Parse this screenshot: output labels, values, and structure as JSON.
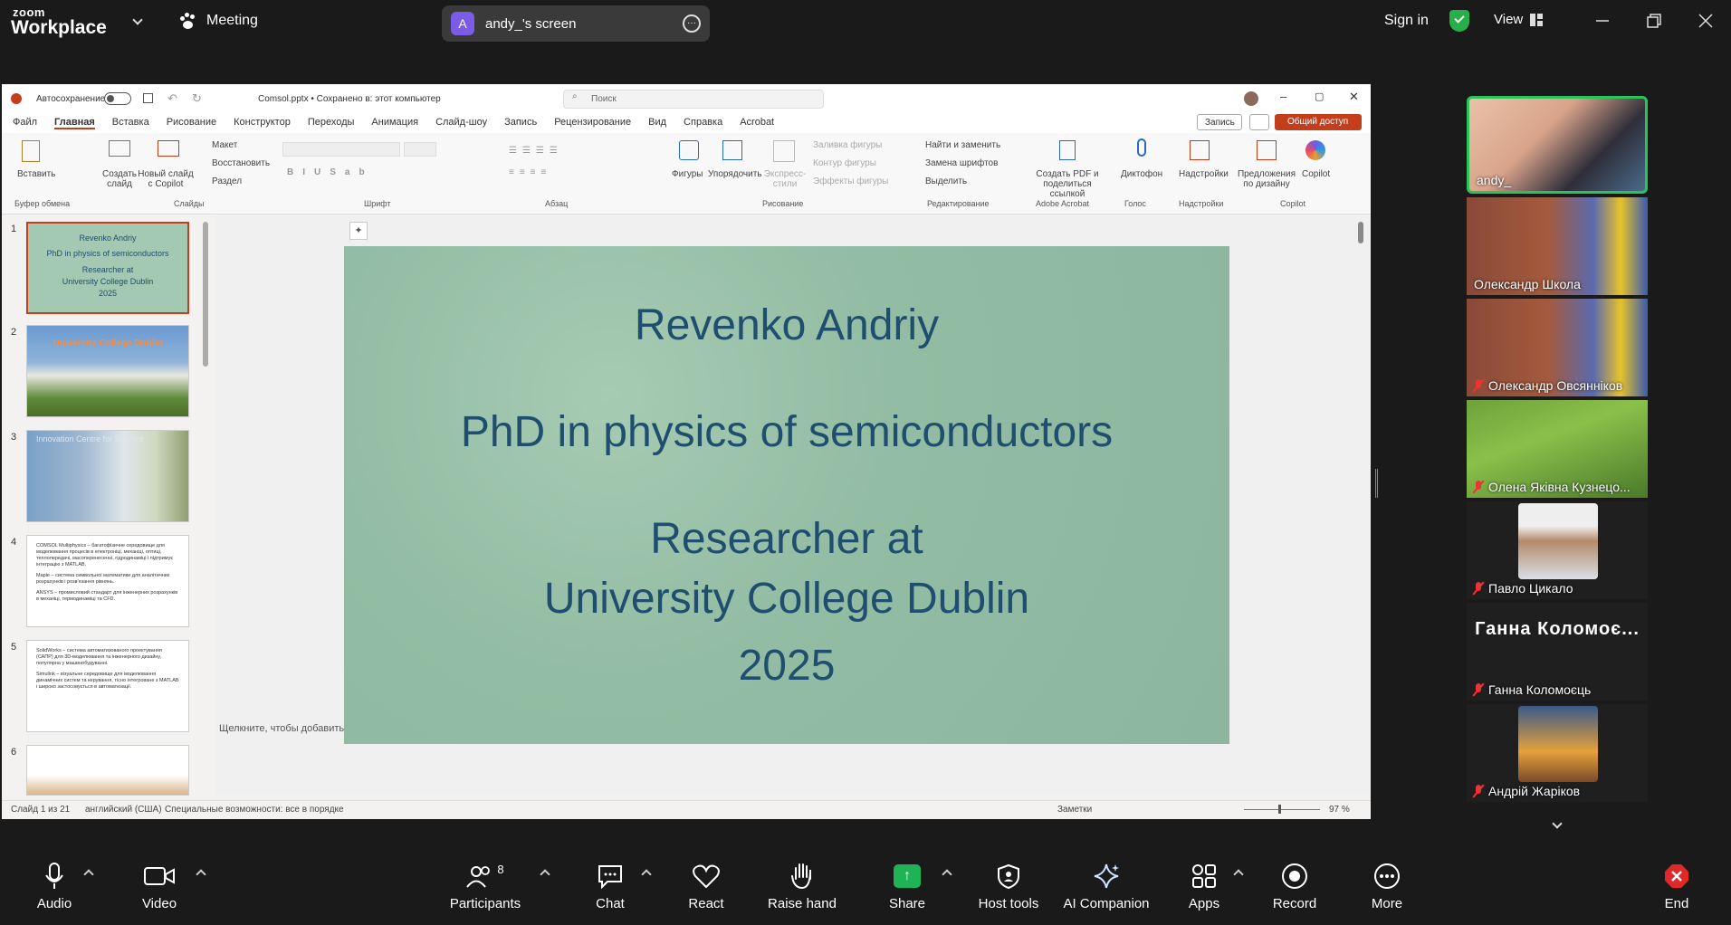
{
  "app": {
    "logo_top": "zoom",
    "logo_bottom": "Workplace",
    "meeting_label": "Meeting",
    "share_label": "andy_'s screen",
    "share_avatar": "A",
    "signin": "Sign in",
    "view": "View"
  },
  "ppt": {
    "autosave": "Автосохранение",
    "filename": "Comsol.pptx • Сохранено в: этот компьютер",
    "search": "Поиск",
    "menu": [
      "Файл",
      "Главная",
      "Вставка",
      "Рисование",
      "Конструктор",
      "Переходы",
      "Анимация",
      "Слайд-шоу",
      "Запись",
      "Рецензирование",
      "Вид",
      "Справка",
      "Acrobat"
    ],
    "record_btn": "Запись",
    "share_btn": "Общий доступ",
    "ribbon": {
      "paste": "Вставить",
      "new_slide": "Создать слайд",
      "copilot_slide": "Новый слайд с Copilot",
      "layout": "Макет",
      "reset": "Восстановить",
      "section": "Раздел",
      "shapes": "Фигуры",
      "arrange": "Упорядочить",
      "express": "Экспресс-стили",
      "fill": "Заливка фигуры",
      "outline": "Контур фигуры",
      "effects": "Эффекты фигуры",
      "find": "Найти и заменить",
      "replace_font": "Замена шрифтов",
      "select": "Выделить",
      "pdf": "Создать PDF и поделиться ссылкой",
      "dictate": "Диктофон",
      "addins": "Надстройки",
      "designer": "Предложения по дизайну",
      "copilot": "Copilot",
      "groups": [
        "Буфер обмена",
        "Слайды",
        "Шрифт",
        "Абзац",
        "Рисование",
        "Редактирование",
        "Adobe Acrobat",
        "Голос",
        "Надстройки",
        "Copilot"
      ]
    },
    "thumb1": [
      "Revenko Andriy",
      "PhD in physics of semiconductors",
      "Researcher at",
      "University College Dublin",
      "2025"
    ],
    "thumb2_title": "University College Dublin",
    "thumb3_title": "Innovation Centre for Science",
    "thumb4": [
      "COMSOL Multiphysics – багатофізичне середовище для моделювання процесів в електроніці, механіці, оптиці, теплопередачі, масоперенесенні, гідродинаміці і підтримує інтеграцію з MATLAB.",
      "Maple – система символьної математики для аналітичних розрахунків і розв'язання рівнянь.",
      "ANSYS – промисловий стандарт для інженерних розрахунків в механіці, термодинаміці та CFD."
    ],
    "thumb5": [
      "SolidWorks – система автоматизованого проектування (САПР) для 3D-моделювання та інженерного дизайну, популярна у машинобудуванні.",
      "Simulink – візуальне середовище для моделювання динамічних систем та керування, тісно інтегроване з MATLAB і широко застосовується в автоматизації."
    ],
    "slide": {
      "line1": "Revenko Andriy",
      "line2": "PhD in physics of semiconductors",
      "line3": "Researcher at",
      "line4": "University College Dublin",
      "line5": "2025"
    },
    "notes": "Щелкните, чтобы добавить заметки",
    "status": {
      "slide": "Слайд 1 из 21",
      "lang": "английский (США)",
      "access": "Специальные возможности: все в порядке",
      "notes": "Заметки",
      "zoom": "97 %"
    }
  },
  "participants": [
    {
      "name": "andy_",
      "muted": false,
      "active": true
    },
    {
      "name": "Олександр Школа",
      "muted": false
    },
    {
      "name": "Олександр Овсяннiков",
      "muted": true
    },
    {
      "name": "Олена Яківна Кузнецо...",
      "muted": true
    },
    {
      "name": "Павло Цикало",
      "muted": true
    },
    {
      "name": "Ганна Коломоєць",
      "muted": true,
      "big": "Ганна Коломоє..."
    },
    {
      "name": "Андрій Жаріков",
      "muted": true
    }
  ],
  "toolbar": {
    "audio": "Audio",
    "video": "Video",
    "participants": "Participants",
    "participants_count": "8",
    "chat": "Chat",
    "react": "React",
    "raise": "Raise hand",
    "share": "Share",
    "host": "Host tools",
    "ai": "AI Companion",
    "apps": "Apps",
    "record": "Record",
    "more": "More",
    "end": "End"
  },
  "colors": {
    "share_green": "#1fb357",
    "end_red": "#e02828",
    "active_border": "#29c45a",
    "slide_text": "#1f4e6e",
    "ppt_accent": "#c43e1c"
  }
}
